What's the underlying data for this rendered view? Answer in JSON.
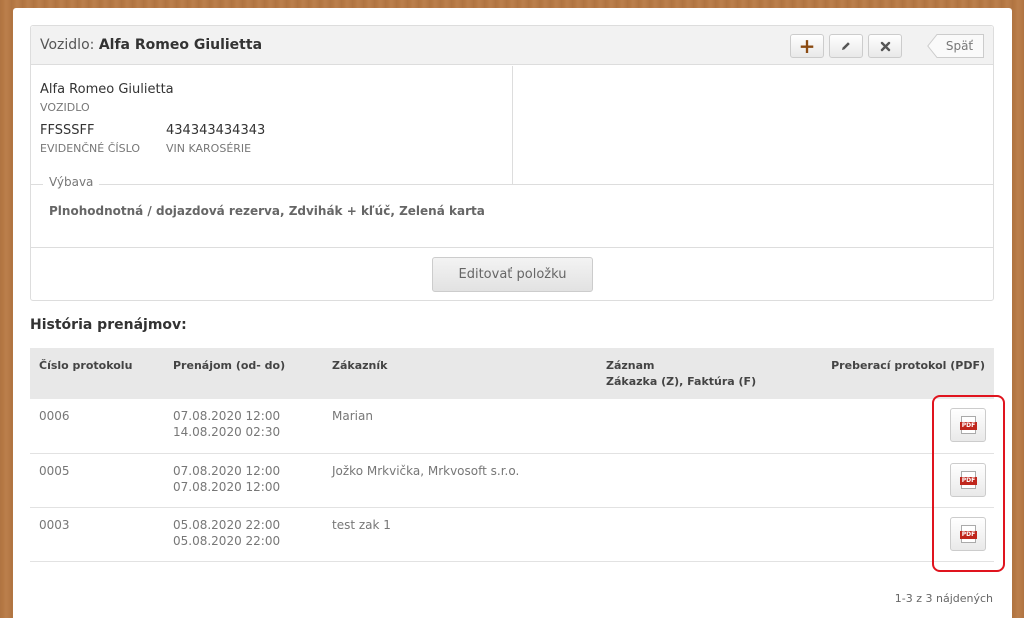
{
  "header": {
    "title_prefix": "Vozidlo:",
    "title_name": "Alfa Romeo Giulietta",
    "add_label": "+",
    "back_label": "Späť"
  },
  "vehicle": {
    "name": "Alfa Romeo Giulietta",
    "name_label": "VOZIDLO",
    "plate": "FFSSSFF",
    "plate_label": "EVIDENČNÉ ČÍSLO",
    "vin": "434343434343",
    "vin_label": "VIN KAROSÉRIE"
  },
  "equipment": {
    "legend": "Výbava",
    "text": "Plnohodnotná / dojazdová rezerva, Zdvihák + kľúč, Zelená karta"
  },
  "edit_button_label": "Editovať položku",
  "history": {
    "title": "História prenájmov:",
    "columns": {
      "protocol": "Číslo protokolu",
      "rental": "Prenájom (od- do)",
      "customer": "Zákazník",
      "record_line1": "Záznam",
      "record_line2": "Zákazka (Z), Faktúra (F)",
      "pdf": "Preberací protokol (PDF)"
    },
    "rows": [
      {
        "protocol": "0006",
        "from": "07.08.2020 12:00",
        "to": "14.08.2020 02:30",
        "customer": "Marian",
        "record": ""
      },
      {
        "protocol": "0005",
        "from": "07.08.2020 12:00",
        "to": "07.08.2020 12:00",
        "customer": "Jožko Mrkvička, Mrkvosoft s.r.o.",
        "record": ""
      },
      {
        "protocol": "0003",
        "from": "05.08.2020 22:00",
        "to": "05.08.2020 22:00",
        "customer": "test zak 1",
        "record": ""
      }
    ],
    "pdf_tag": "PDF",
    "count_text": "1-3 z 3 nájdených"
  },
  "colors": {
    "highlight": "#e0141e",
    "pdf_red": "#c0271d",
    "add_brown": "#8a4a12"
  }
}
